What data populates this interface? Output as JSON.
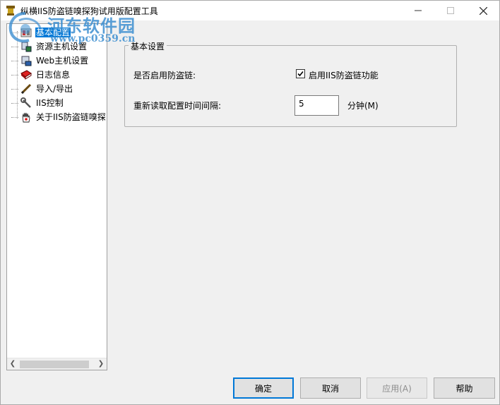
{
  "window": {
    "title": "纵横IIS防盗链嗅探狗试用版配置工具",
    "min_icon": "minimize-icon",
    "max_icon": "maximize-icon",
    "close_icon": "close-icon"
  },
  "watermark": {
    "title": "河东软件园",
    "url": "www.pc0359.cn"
  },
  "tree": {
    "items": [
      {
        "label": "基本配置",
        "icon": "settings-icon",
        "selected": true
      },
      {
        "label": "资源主机设置",
        "icon": "resource-host-icon",
        "selected": false
      },
      {
        "label": "Web主机设置",
        "icon": "web-host-icon",
        "selected": false
      },
      {
        "label": "日志信息",
        "icon": "log-book-icon",
        "selected": false
      },
      {
        "label": "导入/导出",
        "icon": "pencil-icon",
        "selected": false
      },
      {
        "label": "IIS控制",
        "icon": "wrench-icon",
        "selected": false
      },
      {
        "label": "关于IIS防盗链嗅探",
        "icon": "hand-icon",
        "selected": false
      }
    ]
  },
  "basic": {
    "group_title": "基本设置",
    "enable_label": "是否启用防盗链:",
    "enable_checkbox_label": "启用IIS防盗链功能",
    "enable_checked": true,
    "reload_label": "重新读取配置时间间隔:",
    "reload_value": "5",
    "reload_unit": "分钟(M)"
  },
  "buttons": {
    "ok": "确定",
    "cancel": "取消",
    "apply": "应用(A)",
    "help": "帮助"
  },
  "colors": {
    "selection": "#0078d7",
    "watermark": "#3d8fd1"
  }
}
